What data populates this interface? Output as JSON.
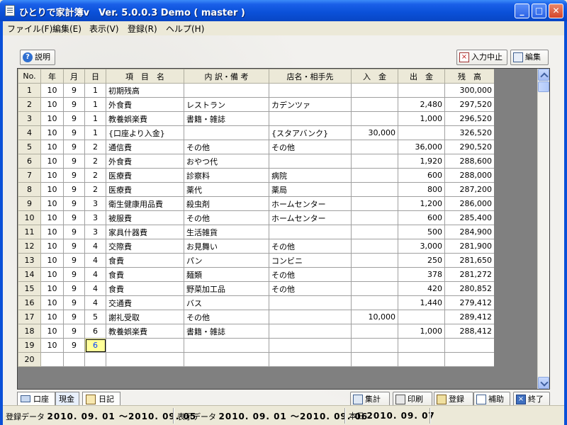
{
  "window": {
    "title": "ひとりで家計簿v　Ver. 5.0.0.3 Demo ( master )"
  },
  "menu": [
    "ファイル(F)",
    "編集(E)",
    "表示(V)",
    "登録(R)",
    "ヘルプ(H)"
  ],
  "toolbar": {
    "help": "説明",
    "cancel_input": "入力中止",
    "edit": "編集"
  },
  "grid": {
    "headers": [
      "No.",
      "年",
      "月",
      "日",
      "項　目　名",
      "内 訳・備 考",
      "店名・相手先",
      "入　金",
      "出　金",
      "残　高"
    ],
    "rows": [
      [
        "1",
        "10",
        "9",
        "1",
        "初期残高",
        "",
        "",
        "",
        "",
        "300,000"
      ],
      [
        "2",
        "10",
        "9",
        "1",
        "外食費",
        "レストラン",
        "カデンツァ",
        "",
        "2,480",
        "297,520"
      ],
      [
        "3",
        "10",
        "9",
        "1",
        "教養娯楽費",
        "書籍・雑誌",
        "",
        "",
        "1,000",
        "296,520"
      ],
      [
        "4",
        "10",
        "9",
        "1",
        "{口座より入金}",
        "",
        "{スタアバンク}",
        "30,000",
        "",
        "326,520"
      ],
      [
        "5",
        "10",
        "9",
        "2",
        "通信費",
        "その他",
        "その他",
        "",
        "36,000",
        "290,520"
      ],
      [
        "6",
        "10",
        "9",
        "2",
        "外食費",
        "おやつ代",
        "",
        "",
        "1,920",
        "288,600"
      ],
      [
        "7",
        "10",
        "9",
        "2",
        "医療費",
        "診察料",
        "病院",
        "",
        "600",
        "288,000"
      ],
      [
        "8",
        "10",
        "9",
        "2",
        "医療費",
        "薬代",
        "薬局",
        "",
        "800",
        "287,200"
      ],
      [
        "9",
        "10",
        "9",
        "3",
        "衛生健康用品費",
        "殺虫剤",
        "ホームセンター",
        "",
        "1,200",
        "286,000"
      ],
      [
        "10",
        "10",
        "9",
        "3",
        "被服費",
        "その他",
        "ホームセンター",
        "",
        "600",
        "285,400"
      ],
      [
        "11",
        "10",
        "9",
        "3",
        "家具什器費",
        "生活雑貨",
        "",
        "",
        "500",
        "284,900"
      ],
      [
        "12",
        "10",
        "9",
        "4",
        "交際費",
        "お見舞い",
        "その他",
        "",
        "3,000",
        "281,900"
      ],
      [
        "13",
        "10",
        "9",
        "4",
        "食費",
        "パン",
        "コンビニ",
        "",
        "250",
        "281,650"
      ],
      [
        "14",
        "10",
        "9",
        "4",
        "食費",
        "麺類",
        "その他",
        "",
        "378",
        "281,272"
      ],
      [
        "15",
        "10",
        "9",
        "4",
        "食費",
        "野菜加工品",
        "その他",
        "",
        "420",
        "280,852"
      ],
      [
        "16",
        "10",
        "9",
        "4",
        "交通費",
        "バス",
        "",
        "",
        "1,440",
        "279,412"
      ],
      [
        "17",
        "10",
        "9",
        "5",
        "謝礼受取",
        "その他",
        "",
        "10,000",
        "",
        "289,412"
      ],
      [
        "18",
        "10",
        "9",
        "6",
        "教養娯楽費",
        "書籍・雑誌",
        "",
        "",
        "1,000",
        "288,412"
      ],
      [
        "19",
        "10",
        "9",
        "6",
        "",
        "",
        "",
        "",
        "",
        ""
      ],
      [
        "20",
        "",
        "",
        "",
        "",
        "",
        "",
        "",
        "",
        ""
      ]
    ]
  },
  "tabs": {
    "account": "口座",
    "cash": "現金",
    "diary": "日記"
  },
  "bottom_buttons": {
    "summary": "集計",
    "print": "印刷",
    "register": "登録",
    "assist": "補助",
    "exit": "終了"
  },
  "status": {
    "reg_label": "登録データ",
    "reg_value": "2010. 09. 01 ～2010. 09. 05",
    "disp_label": "表示データ",
    "disp_value": "2010. 09. 01 ～2010. 09. 06",
    "today_label": "本日",
    "today_value": "2010. 09. 07"
  },
  "colors": {
    "title_blue": "#0a50d8",
    "selected_cell": "#ffff99"
  }
}
